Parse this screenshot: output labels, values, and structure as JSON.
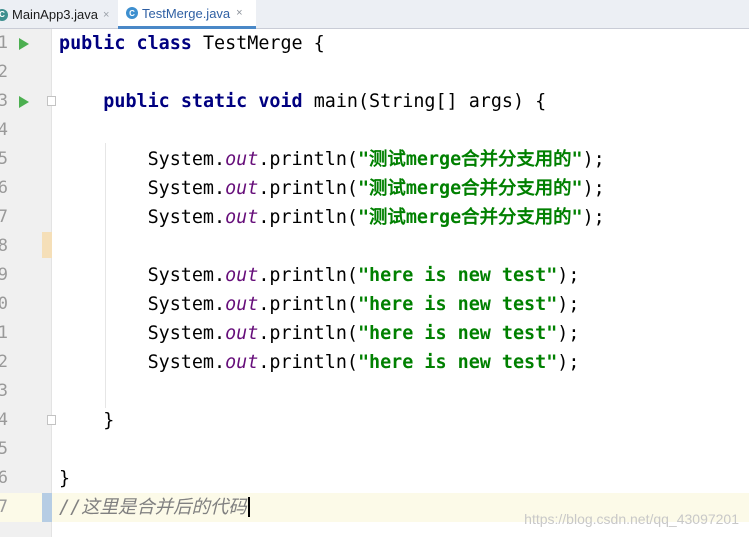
{
  "tabs": [
    {
      "label": "MainApp3.java",
      "icon": "java-class-icon",
      "active": false
    },
    {
      "label": "TestMerge.java",
      "icon": "java-class-icon",
      "active": true
    }
  ],
  "tab_close_glyph": "×",
  "tab_icon_letter": "C",
  "lines": [
    {
      "num": "1",
      "code": [
        [
          "kw",
          "public"
        ],
        [
          "t",
          " "
        ],
        [
          "kw",
          "class"
        ],
        [
          "t",
          " TestMerge {"
        ]
      ]
    },
    {
      "num": "2",
      "code": []
    },
    {
      "num": "3",
      "code": [
        [
          "t",
          "    "
        ],
        [
          "kw",
          "public"
        ],
        [
          "t",
          " "
        ],
        [
          "kw",
          "static"
        ],
        [
          "t",
          " "
        ],
        [
          "kw",
          "void"
        ],
        [
          "t",
          " main(String[] args) {"
        ]
      ]
    },
    {
      "num": "4",
      "code": []
    },
    {
      "num": "5",
      "code": [
        [
          "t",
          "        System."
        ],
        [
          "fld",
          "out"
        ],
        [
          "t",
          ".println("
        ],
        [
          "str",
          "\"测试merge合并分支用的\""
        ],
        [
          "t",
          ");"
        ]
      ]
    },
    {
      "num": "6",
      "code": [
        [
          "t",
          "        System."
        ],
        [
          "fld",
          "out"
        ],
        [
          "t",
          ".println("
        ],
        [
          "str",
          "\"测试merge合并分支用的\""
        ],
        [
          "t",
          ");"
        ]
      ]
    },
    {
      "num": "7",
      "code": [
        [
          "t",
          "        System."
        ],
        [
          "fld",
          "out"
        ],
        [
          "t",
          ".println("
        ],
        [
          "str",
          "\"测试merge合并分支用的\""
        ],
        [
          "t",
          ");"
        ]
      ]
    },
    {
      "num": "8",
      "code": []
    },
    {
      "num": "9",
      "code": [
        [
          "t",
          "        System."
        ],
        [
          "fld",
          "out"
        ],
        [
          "t",
          ".println("
        ],
        [
          "str",
          "\"here is new test\""
        ],
        [
          "t",
          ");"
        ]
      ]
    },
    {
      "num": "0",
      "code": [
        [
          "t",
          "        System."
        ],
        [
          "fld",
          "out"
        ],
        [
          "t",
          ".println("
        ],
        [
          "str",
          "\"here is new test\""
        ],
        [
          "t",
          ");"
        ]
      ]
    },
    {
      "num": "1",
      "code": [
        [
          "t",
          "        System."
        ],
        [
          "fld",
          "out"
        ],
        [
          "t",
          ".println("
        ],
        [
          "str",
          "\"here is new test\""
        ],
        [
          "t",
          ");"
        ]
      ]
    },
    {
      "num": "2",
      "code": [
        [
          "t",
          "        System."
        ],
        [
          "fld",
          "out"
        ],
        [
          "t",
          ".println("
        ],
        [
          "str",
          "\"here is new test\""
        ],
        [
          "t",
          ");"
        ]
      ]
    },
    {
      "num": "3",
      "code": []
    },
    {
      "num": "4",
      "code": [
        [
          "t",
          "    }"
        ]
      ]
    },
    {
      "num": "5",
      "code": []
    },
    {
      "num": "6",
      "code": [
        [
          "t",
          "}"
        ]
      ]
    },
    {
      "num": "7",
      "code": [
        [
          "cmt",
          "//这里是合并后的代码"
        ]
      ]
    }
  ],
  "run_lines": [
    0,
    2
  ],
  "fold_lines": [
    2,
    13
  ],
  "current_line": 16,
  "watermark": "https://blog.csdn.net/qq_43097201",
  "colors": {
    "keyword": "#000080",
    "string": "#008000",
    "field": "#660e7a",
    "comment": "#808080",
    "run": "#4caf50"
  }
}
